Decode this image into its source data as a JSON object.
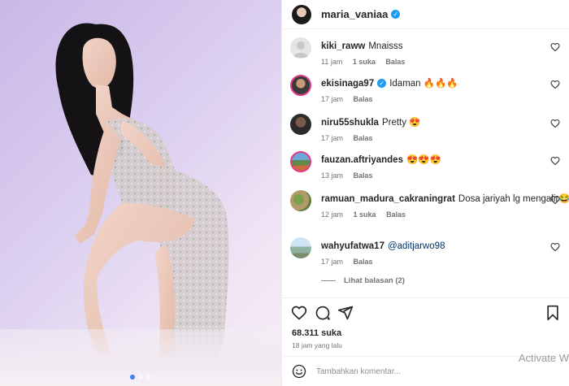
{
  "post": {
    "author": "maria_vaniaa",
    "likes": "68.311 suka",
    "timestamp": "18 jam yang lalu",
    "add_comment_placeholder": "Tambahkan komentar..."
  },
  "comments": [
    {
      "user": "kiki_raww",
      "text": "Mnaisss",
      "time": "11 jam",
      "likes": "1 suka",
      "reply": "Balas",
      "verified": false
    },
    {
      "user": "ekisinaga97",
      "text": "Idaman 🔥🔥🔥",
      "time": "17 jam",
      "likes": "",
      "reply": "Balas",
      "verified": true
    },
    {
      "user": "niru55shukla",
      "text": "Pretty 😍",
      "time": "17 jam",
      "likes": "",
      "reply": "Balas",
      "verified": false
    },
    {
      "user": "fauzan.aftriyandes",
      "text": "😍😍😍",
      "time": "13 jam",
      "likes": "",
      "reply": "Balas",
      "verified": false
    },
    {
      "user": "ramuan_madura_cakraningrat",
      "text": "Dosa jariyah lg mengalir😂😂",
      "time": "12 jam",
      "likes": "1 suka",
      "reply": "Balas",
      "verified": false
    },
    {
      "user": "wahyufatwa17",
      "text": "@aditjarwo98",
      "time": "17 jam",
      "likes": "",
      "reply": "Balas",
      "verified": false
    }
  ],
  "view_replies": "Lihat balasan (2)",
  "watermark": "Activate W",
  "icons": {
    "like": "heart-icon",
    "comment": "comment-icon",
    "share": "share-icon",
    "save": "bookmark-icon",
    "emoji": "emoji-icon",
    "verified": "verified-badge-icon"
  },
  "colors": {
    "background_gradient": [
      "#c9b7e6",
      "#f6eef6"
    ],
    "carousel_active_dot": "#3b82f6",
    "verified": "#1d9bf0",
    "mention": "#00376b"
  },
  "carousel": {
    "count": 3,
    "active": 1
  }
}
